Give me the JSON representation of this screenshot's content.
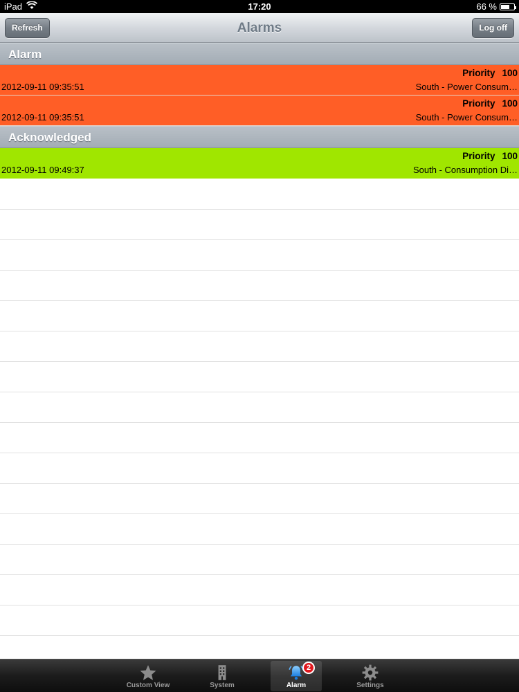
{
  "status_bar": {
    "device": "iPad",
    "time": "17:20",
    "battery": "66 %",
    "battery_level": 0.66
  },
  "navbar": {
    "title": "Alarms",
    "refresh_label": "Refresh",
    "logoff_label": "Log off"
  },
  "sections": {
    "alarm": {
      "header": "Alarm",
      "rows": [
        {
          "priority_label": "Priority",
          "priority_value": "100",
          "date": "2012-09-11 09:35:51",
          "description": "South - Power Consum…",
          "color": "#ff5e26"
        },
        {
          "priority_label": "Priority",
          "priority_value": "100",
          "date": "2012-09-11 09:35:51",
          "description": "South - Power Consum…",
          "color": "#ff5e26"
        }
      ]
    },
    "acknowledged": {
      "header": "Acknowledged",
      "rows": [
        {
          "priority_label": "Priority",
          "priority_value": "100",
          "date": "2012-09-11 09:49:37",
          "description": "South - Consumption Di…",
          "color": "#a0e600"
        }
      ]
    }
  },
  "tabbar": {
    "tabs": [
      {
        "label": "Custom View",
        "icon": "star-icon"
      },
      {
        "label": "System",
        "icon": "building-icon"
      },
      {
        "label": "Alarm",
        "icon": "bell-icon",
        "badge": "2",
        "active": true
      },
      {
        "label": "Settings",
        "icon": "gear-icon"
      }
    ]
  }
}
